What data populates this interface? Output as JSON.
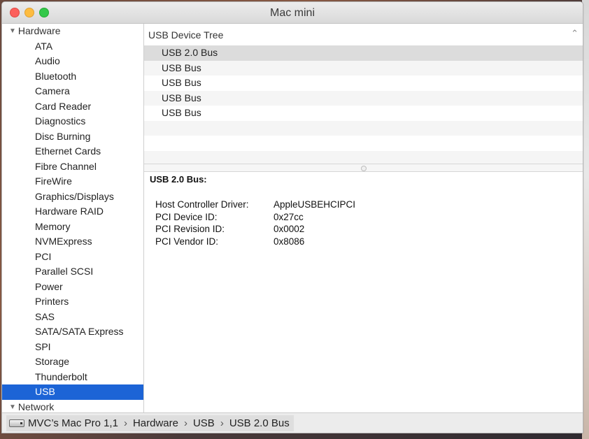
{
  "window": {
    "title": "Mac mini"
  },
  "sidebar": {
    "hardware_label": "Hardware",
    "items": [
      "ATA",
      "Audio",
      "Bluetooth",
      "Camera",
      "Card Reader",
      "Diagnostics",
      "Disc Burning",
      "Ethernet Cards",
      "Fibre Channel",
      "FireWire",
      "Graphics/Displays",
      "Hardware RAID",
      "Memory",
      "NVMExpress",
      "PCI",
      "Parallel SCSI",
      "Power",
      "Printers",
      "SAS",
      "SATA/SATA Express",
      "SPI",
      "Storage",
      "Thunderbolt",
      "USB"
    ],
    "selected": "USB",
    "network_label": "Network"
  },
  "tree": {
    "header": "USB Device Tree",
    "rows": [
      "USB 2.0 Bus",
      "USB Bus",
      "USB Bus",
      "USB Bus",
      "USB Bus"
    ]
  },
  "detail": {
    "title": "USB 2.0 Bus:",
    "properties": [
      {
        "key": "Host Controller Driver:",
        "value": "AppleUSBEHCIPCI"
      },
      {
        "key": "PCI Device ID:",
        "value": "0x27cc"
      },
      {
        "key": "PCI Revision ID:",
        "value": "0x0002"
      },
      {
        "key": "PCI Vendor ID:",
        "value": "0x8086"
      }
    ]
  },
  "statusbar": {
    "path": [
      "MVC’s Mac Pro 1,1",
      "Hardware",
      "USB",
      "USB 2.0 Bus"
    ]
  },
  "colors": {
    "selection": "#1c64d6",
    "close": "#fc605c",
    "minimize": "#fdbc40",
    "zoom": "#34c84a"
  },
  "icons": {
    "group_toggle": "disclosure-triangle-icon",
    "tree_collapse": "chevron-up-icon",
    "computer": "mac-pro-icon"
  }
}
